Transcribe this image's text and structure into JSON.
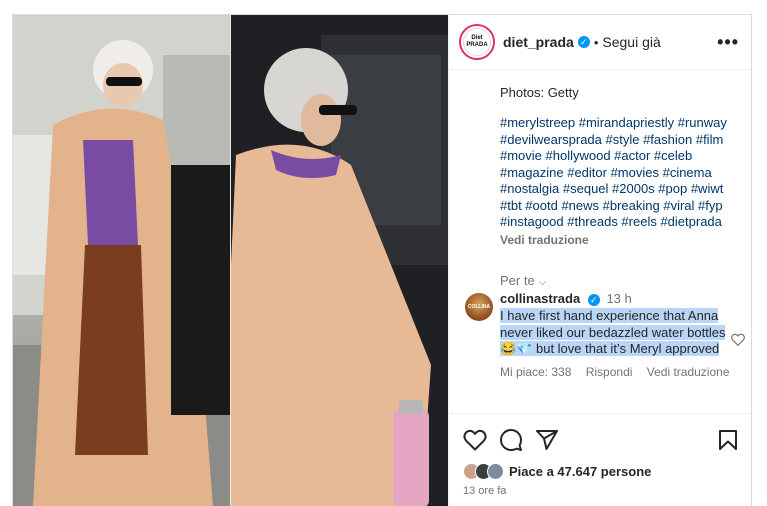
{
  "post": {
    "username": "diet_prada",
    "separator": "•",
    "follow_label": "Segui già",
    "more_label": "•••",
    "avatar_text_top": "Diet",
    "avatar_text_bottom": "PRADA"
  },
  "caption": {
    "credit": "Photos: Getty",
    "hashtags": "#merylstreep #mirandapriestly #runway #devilwearsprada #style #fashion #film #movie #hollywood #actor #celeb #magazine #editor #movies #cinema #nostalgia #sequel #2000s #pop #wiwt #tbt #ootd #news #breaking #viral #fyp #instagood #threads #reels #dietprada",
    "see_translation": "Vedi traduzione"
  },
  "filter": {
    "label": "Per te",
    "chevron": "⌵"
  },
  "comment": {
    "username": "collinastrada",
    "time": "13 h",
    "avatar_text": "COLLINA",
    "text_part1": "I have first hand experience that Anna never liked our bedazzled water bottles ",
    "emoji": "😂💎",
    "text_part2": " but love that it’s Meryl approved",
    "likes": "Mi piace: 338",
    "reply": "Rispondi",
    "translate": "Vedi traduzione"
  },
  "footer": {
    "likes_text": "Piace a 47.647 persone",
    "timestamp": "13 ore fa"
  },
  "colors": {
    "link_blue": "#00376b",
    "verified_blue": "#0095f6",
    "highlight": "#b9d6f7"
  }
}
